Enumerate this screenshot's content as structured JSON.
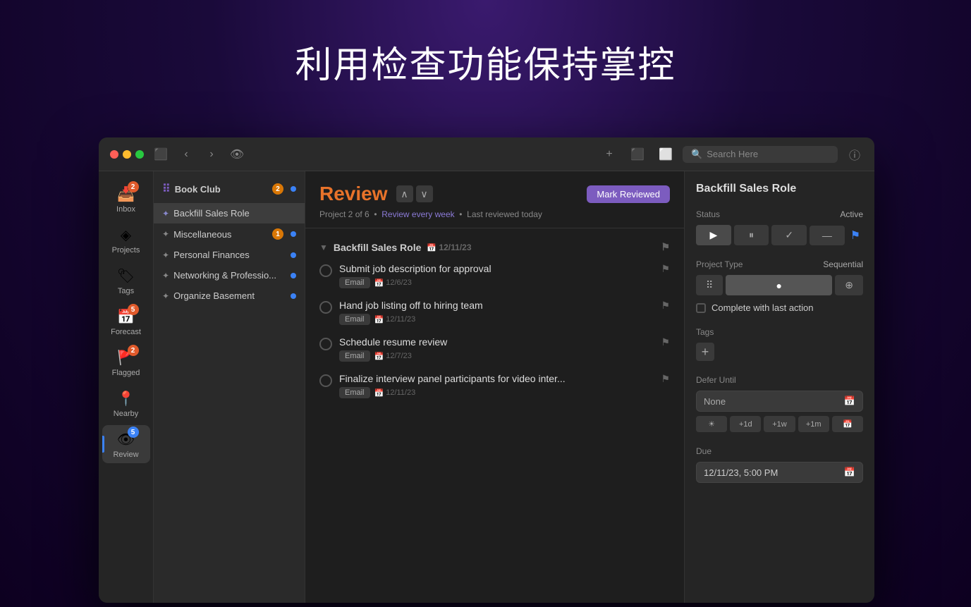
{
  "page": {
    "title": "利用检查功能保持掌控"
  },
  "titlebar": {
    "search_placeholder": "Search Here",
    "add_icon": "+",
    "inbox_icon": "⬛",
    "expand_icon": "⬜"
  },
  "sidebar": {
    "items": [
      {
        "id": "inbox",
        "label": "Inbox",
        "icon": "📥",
        "badge": "2",
        "badge_type": "orange"
      },
      {
        "id": "projects",
        "label": "Projects",
        "icon": "◈",
        "badge": null
      },
      {
        "id": "tags",
        "label": "Tags",
        "icon": "🏷",
        "badge": null
      },
      {
        "id": "forecast",
        "label": "Forecast",
        "icon": "📅",
        "badge": "5",
        "badge_type": "orange"
      },
      {
        "id": "flagged",
        "label": "Flagged",
        "icon": "🚩",
        "badge": "2",
        "badge_type": "orange"
      },
      {
        "id": "nearby",
        "label": "Nearby",
        "icon": "📍",
        "badge": null
      },
      {
        "id": "review",
        "label": "Review",
        "icon": "👁",
        "badge": "5",
        "badge_type": "blue",
        "active": true
      }
    ]
  },
  "project_list": {
    "header": "Book Club",
    "header_badge": "2",
    "items": [
      {
        "name": "Backfill Sales Role",
        "selected": true,
        "badge": null
      },
      {
        "name": "Miscellaneous",
        "badge": "1",
        "dot_blue": true
      },
      {
        "name": "Personal Finances",
        "dot_blue": true
      },
      {
        "name": "Networking & Professio...",
        "dot_blue": true
      },
      {
        "name": "Organize Basement",
        "dot_blue": true
      }
    ]
  },
  "task_view": {
    "title": "Review",
    "meta": "Project 2 of 6  •  Review every week  •  Last reviewed today",
    "meta_link": "Review every week",
    "mark_reviewed_label": "Mark Reviewed",
    "task_group": {
      "name": "Backfill Sales Role",
      "date": "12/11/23"
    },
    "tasks": [
      {
        "name": "Submit job description for approval",
        "tag": "Email",
        "date": "12/6/23",
        "flagged": false
      },
      {
        "name": "Hand job listing off to hiring team",
        "tag": "Email",
        "date": "12/11/23",
        "flagged": false
      },
      {
        "name": "Schedule resume review",
        "tag": "Email",
        "date": "12/7/23",
        "flagged": false
      },
      {
        "name": "Finalize interview panel participants for video inter...",
        "tag": "Email",
        "date": "12/11/23",
        "flagged": false
      }
    ]
  },
  "inspector": {
    "title": "Backfill Sales Role",
    "status_label": "Status",
    "status_value": "Active",
    "status_buttons": [
      {
        "icon": "▶",
        "active": true
      },
      {
        "icon": "⏸",
        "active": false
      },
      {
        "icon": "✓",
        "active": false
      },
      {
        "icon": "—",
        "active": false
      }
    ],
    "project_type_label": "Project Type",
    "project_type_value": "Sequential",
    "project_type_buttons": [
      {
        "icon": "⠿",
        "active": false
      },
      {
        "icon": "●",
        "active": true
      },
      {
        "icon": "⊕",
        "active": false
      }
    ],
    "complete_last_action": "Complete with last action",
    "tags_label": "Tags",
    "tags_add": "+",
    "defer_until_label": "Defer Until",
    "defer_value": "None",
    "defer_quick": [
      "+1d",
      "+1w",
      "+1m"
    ],
    "due_label": "Due",
    "due_value": "12/11/23, 5:00 PM"
  }
}
